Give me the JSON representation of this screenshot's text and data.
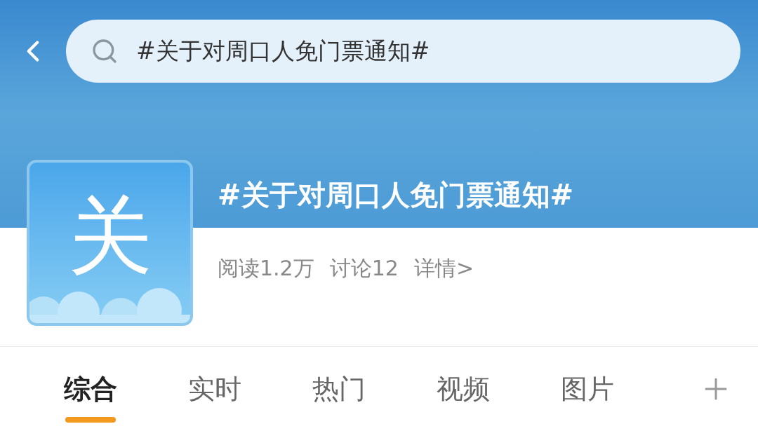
{
  "search": {
    "value": "#关于对周口人免门票通知#"
  },
  "topic": {
    "avatar_char": "关",
    "title": "#关于对周口人免门票通知#"
  },
  "stats": [
    "阅读1.2万",
    "讨论12"
  ],
  "details_link": "详情>",
  "tabs": [
    {
      "label": "综合",
      "selected": true
    },
    {
      "label": "实时",
      "selected": false
    },
    {
      "label": "热门",
      "selected": false
    },
    {
      "label": "视频",
      "selected": false
    },
    {
      "label": "图片",
      "selected": false
    }
  ]
}
